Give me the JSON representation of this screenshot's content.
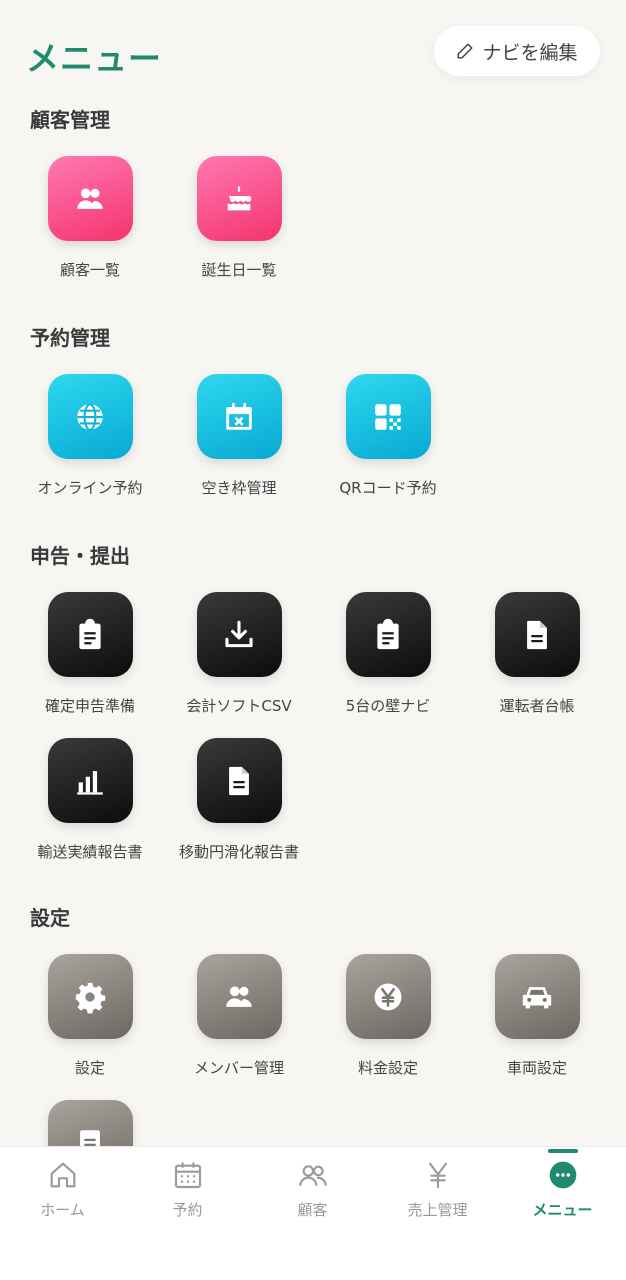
{
  "header": {
    "title": "メニュー",
    "edit_button_label": "ナビを編集"
  },
  "sections": [
    {
      "title": "顧客管理",
      "items": [
        {
          "label": "顧客一覧",
          "icon": "users-icon"
        },
        {
          "label": "誕生日一覧",
          "icon": "cake-icon"
        }
      ]
    },
    {
      "title": "予約管理",
      "items": [
        {
          "label": "オンライン予約",
          "icon": "globe-icon"
        },
        {
          "label": "空き枠管理",
          "icon": "calendar-x-icon"
        },
        {
          "label": "QRコード予約",
          "icon": "qr-code-icon"
        }
      ]
    },
    {
      "title": "申告・提出",
      "items": [
        {
          "label": "確定申告準備",
          "icon": "clipboard-icon"
        },
        {
          "label": "会計ソフトCSV",
          "icon": "download-icon"
        },
        {
          "label": "5台の壁ナビ",
          "icon": "clipboard-icon"
        },
        {
          "label": "運転者台帳",
          "icon": "document-icon"
        },
        {
          "label": "輸送実績報告書",
          "icon": "bar-chart-icon"
        },
        {
          "label": "移動円滑化報告書",
          "icon": "document-icon"
        }
      ]
    },
    {
      "title": "設定",
      "items": [
        {
          "label": "設定",
          "icon": "gear-icon"
        },
        {
          "label": "メンバー管理",
          "icon": "users-icon"
        },
        {
          "label": "料金設定",
          "icon": "yen-icon"
        },
        {
          "label": "車両設定",
          "icon": "car-icon"
        },
        {
          "label": "",
          "icon": "document-icon"
        }
      ]
    }
  ],
  "bottom_nav": [
    {
      "label": "ホーム",
      "icon": "home-icon",
      "active": false
    },
    {
      "label": "予約",
      "icon": "calendar-icon",
      "active": false
    },
    {
      "label": "顧客",
      "icon": "users-outline-icon",
      "active": false
    },
    {
      "label": "売上管理",
      "icon": "yen-outline-icon",
      "active": false
    },
    {
      "label": "メニュー",
      "icon": "more-icon",
      "active": true
    }
  ],
  "colors": {
    "accent": "#1f8a6e",
    "customer_tiles": "#f5336f",
    "reservation_tiles": "#07a9d3",
    "filing_tiles": "#111111",
    "settings_tiles": "#7a746e"
  }
}
